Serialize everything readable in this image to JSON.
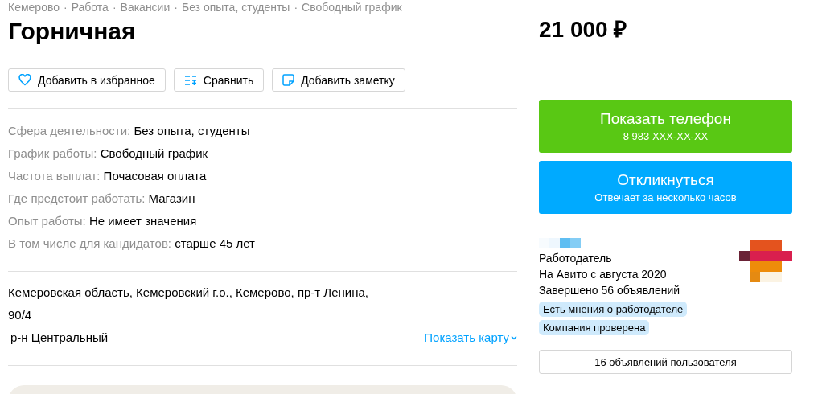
{
  "breadcrumbs": [
    "Кемерово",
    "Работа",
    "Вакансии",
    "Без опыта, студенты",
    "Свободный график"
  ],
  "breadcrumb_separator": "·",
  "title": "Горничная",
  "price": "21 000 ₽",
  "actions": [
    {
      "kind": "favorite",
      "label": "Добавить в избранное"
    },
    {
      "kind": "compare",
      "label": "Сравнить"
    },
    {
      "kind": "note",
      "label": "Добавить заметку"
    }
  ],
  "params": [
    {
      "label": "Сфера деятельности:",
      "value": "Без опыта, студенты"
    },
    {
      "label": "График работы:",
      "value": "Свободный график"
    },
    {
      "label": "Частота выплат:",
      "value": "Почасовая оплата"
    },
    {
      "label": "Где предстоит работать:",
      "value": "Магазин"
    },
    {
      "label": "Опыт работы:",
      "value": "Не имеет значения"
    },
    {
      "label": "В том числе для кандидатов:",
      "value": "старше 45 лет"
    }
  ],
  "address": {
    "lines": [
      "Кемеровская область, Кемеровский г.о., Кемерово, пр-т Ленина,",
      "90/4"
    ],
    "district": "р-н Центральный",
    "map_link": "Показать карту"
  },
  "phone_button": {
    "label": "Показать телефон",
    "sub": "8 983 XXX-XX-XX"
  },
  "respond_button": {
    "label": "Откликнуться",
    "sub": "Отвечает за несколько часов"
  },
  "seller": {
    "role": "Работодатель",
    "since": "На Авито с августа 2020",
    "completed": "Завершено 56 объявлений",
    "badges": [
      "Есть мнения о работодателе",
      "Компания проверена"
    ],
    "listings_button": "16 объявлений пользователя"
  }
}
